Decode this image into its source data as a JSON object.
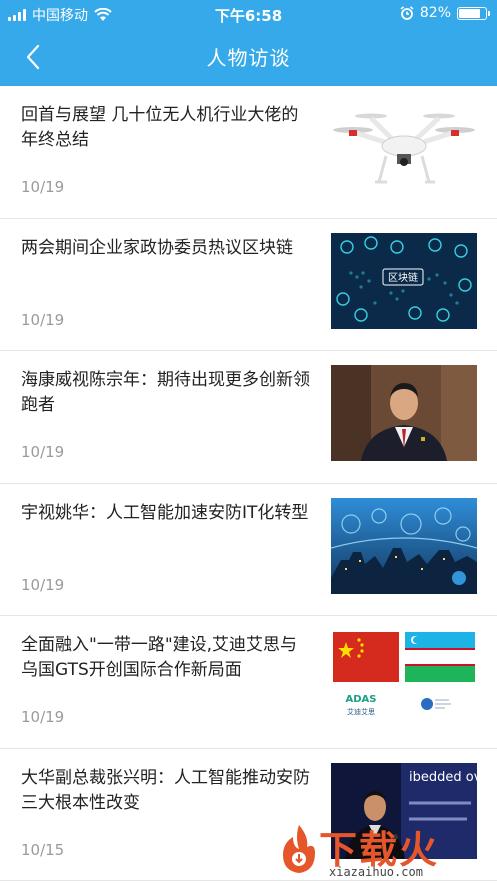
{
  "status_bar": {
    "carrier": "中国移动",
    "time": "下午6:58",
    "battery": "82%",
    "battery_level": 0.82,
    "icons": [
      "signal-icon",
      "wifi-icon",
      "alarm-icon",
      "battery-icon"
    ]
  },
  "navbar": {
    "title": "人物访谈",
    "back_icon": "chevron-left-icon"
  },
  "colors": {
    "header_bg": "#36a9ea",
    "date_text": "#9a9a9a",
    "divider": "#e6e6e6"
  },
  "articles": [
    {
      "title": "回首与展望 几十位无人机行业大佬的年终总结",
      "date": "10/19",
      "image": "drone-image"
    },
    {
      "title": "两会期间企业家政协委员热议区块链",
      "date": "10/19",
      "image": "blockchain-image",
      "image_label": "区块链"
    },
    {
      "title": "海康威视陈宗年：期待出现更多创新领跑者",
      "date": "10/19",
      "image": "portrait-image"
    },
    {
      "title": "宇视姚华：人工智能加速安防IT化转型",
      "date": "10/19",
      "image": "smart-city-image"
    },
    {
      "title": "全面融入\"一带一路\"建设,艾迪艾思与乌国GTS开创国际合作新局面",
      "date": "10/19",
      "image": "flags-image",
      "image_labels": [
        "ADAS",
        "艾迪艾思"
      ]
    },
    {
      "title": "大华副总裁张兴明：人工智能推动安防三大根本性改变",
      "date": "10/15",
      "image": "speaker-image",
      "image_label": "ibedded ov"
    }
  ],
  "watermark": {
    "text": "下载火",
    "url": "xiazaihuo.com"
  }
}
